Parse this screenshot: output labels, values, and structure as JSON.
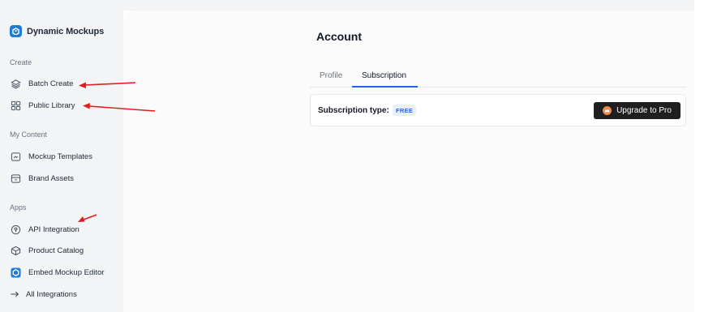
{
  "brand": {
    "name": "Dynamic Mockups",
    "logo_color": "#1e7bd6"
  },
  "sidebar": {
    "sections": [
      {
        "label": "Create",
        "items": [
          {
            "label": "Batch Create",
            "icon": "layers-icon"
          },
          {
            "label": "Public Library",
            "icon": "grid-icon"
          }
        ]
      },
      {
        "label": "My Content",
        "items": [
          {
            "label": "Mockup Templates",
            "icon": "template-icon"
          },
          {
            "label": "Brand Assets",
            "icon": "box-icon"
          }
        ]
      },
      {
        "label": "Apps",
        "items": [
          {
            "label": "API Integration",
            "icon": "api-icon"
          },
          {
            "label": "Product Catalog",
            "icon": "cube-icon"
          },
          {
            "label": "Embed Mockup Editor",
            "icon": "app-logo-icon"
          },
          {
            "label": "All Integrations",
            "icon": "arrow-right-icon"
          }
        ]
      }
    ]
  },
  "main": {
    "title": "Account",
    "tabs": [
      {
        "label": "Profile",
        "active": false
      },
      {
        "label": "Subscription",
        "active": true
      }
    ],
    "subscription": {
      "label": "Subscription type:",
      "plan": "FREE",
      "upgrade_label": "Upgrade to Pro"
    }
  },
  "colors": {
    "sidebar_bg": "#f3f4f6",
    "accent": "#2563eb",
    "button_bg": "#1f1f1f",
    "annotation_arrow": "#e11d1d"
  }
}
